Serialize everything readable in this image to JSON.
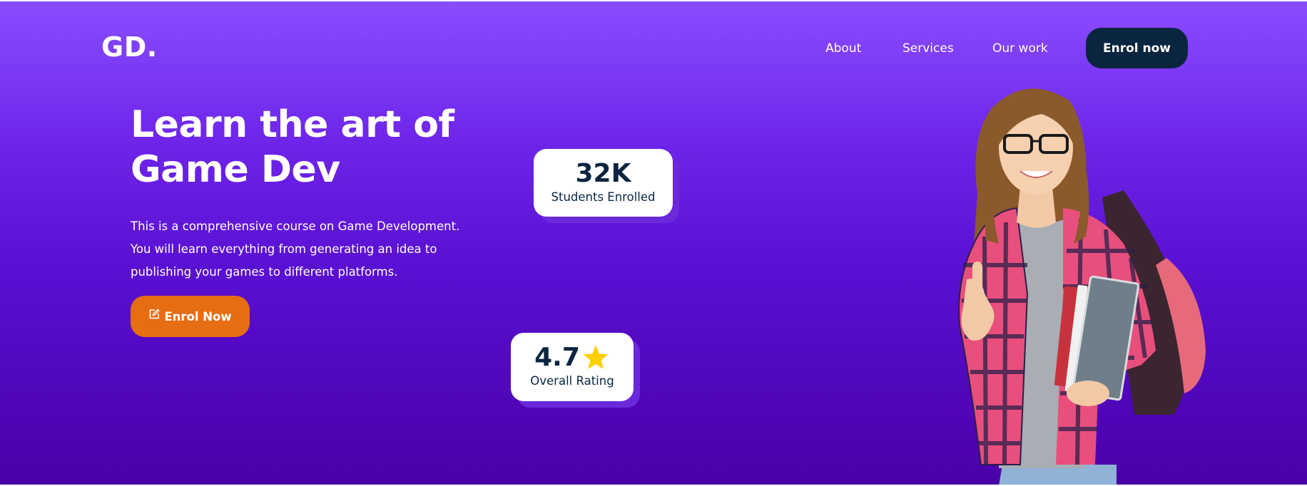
{
  "header": {
    "logo": "GD.",
    "nav": {
      "about": "About",
      "services": "Services",
      "our_work": "Our work"
    },
    "cta_label": "Enrol now"
  },
  "hero": {
    "title_line1": "Learn the art of",
    "title_line2": "Game Dev",
    "description": "This is a comprehensive course on Game Development. You will learn everything from generating an idea to publishing your games to different platforms.",
    "cta_label": "Enrol Now",
    "cta_icon": "edit-icon"
  },
  "stats": {
    "students": {
      "value": "32K",
      "label": "Students Enrolled"
    },
    "rating": {
      "value": "4.7",
      "label": "Overall Rating",
      "icon": "star-icon"
    }
  },
  "colors": {
    "gradient_top": "#8a4dff",
    "gradient_bottom": "#4a00a8",
    "navy": "#0a2540",
    "orange": "#e76d13",
    "star": "#ffd000",
    "card_shadow": "#6a2ad9"
  }
}
